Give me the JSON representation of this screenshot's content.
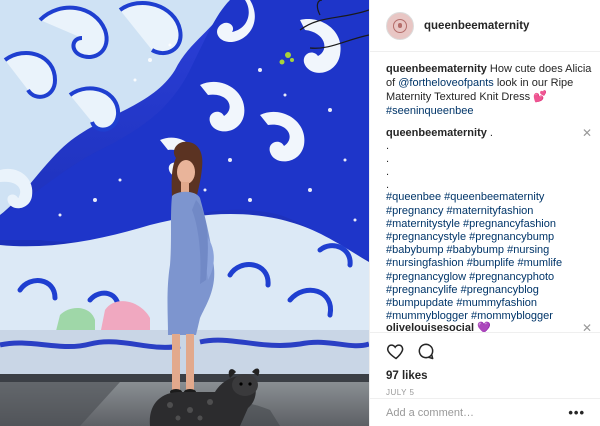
{
  "header": {
    "username": "queenbeematernity",
    "avatar_icon": "queen-bee-logo-icon"
  },
  "caption": {
    "username": "queenbeematernity",
    "text_before": " How cute does Alicia of ",
    "mention": "@fortheloveofpants",
    "text_after": " look in our Ripe Maternity Textured Knit Dress ",
    "emoji": "💕",
    "hashtag": "#seeninqueenbee"
  },
  "comment1": {
    "username": "queenbeematernity",
    "text": " .",
    "dots": [
      ".",
      ".",
      ".",
      "."
    ],
    "hashtags": [
      "#queenbee #queenbeematernity",
      "#pregnancy #maternityfashion",
      "#maternitystyle #pregnancyfashion",
      "#pregnancystyle #pregnancybump",
      "#babybump #babybump #nursing",
      "#nursingfashion #bumplife #mumlife",
      "#pregnancyglow #pregnancyphoto",
      "#pregnancylife #pregnancyblog",
      "#bumpupdate #mummyfashion",
      "#mummyblogger #mommyblogger"
    ],
    "close_label": "✕"
  },
  "comment2": {
    "username": "olivelouisesocial",
    "emoji": "💜",
    "close_label": "✕"
  },
  "actions": {
    "like_icon": "heart-icon",
    "comment_icon": "comment-bubble-icon",
    "likes": "97 likes",
    "date": "JULY 5"
  },
  "add_comment": {
    "placeholder": "Add a comment…",
    "more_label": "•••"
  },
  "colors": {
    "link": "#003569",
    "wall_blue": "#1f3fd0",
    "muted": "#999999"
  }
}
